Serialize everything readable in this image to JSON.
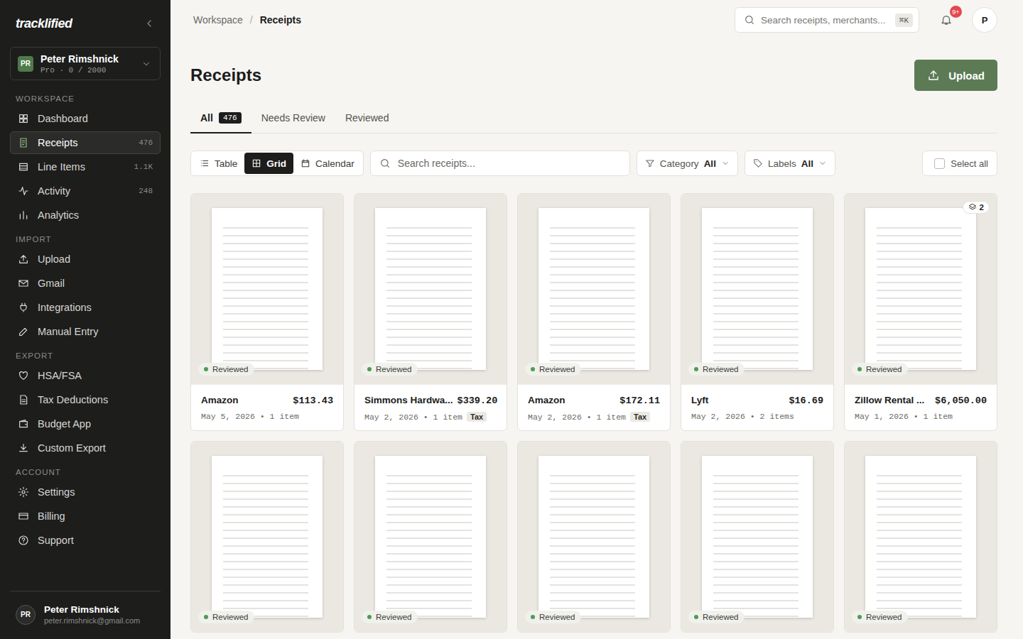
{
  "sidebar": {
    "logo": "tracklified",
    "account": {
      "initials": "PR",
      "name": "Peter Rimshnick",
      "plan": "Pro · 0 / 2000"
    },
    "sections": [
      {
        "title": "WORKSPACE",
        "items": [
          {
            "label": "Dashboard",
            "selected": false
          },
          {
            "label": "Receipts",
            "count": "476",
            "selected": true
          },
          {
            "label": "Line Items",
            "count": "1.1K",
            "selected": false
          },
          {
            "label": "Activity",
            "count": "248",
            "selected": false
          },
          {
            "label": "Analytics",
            "selected": false
          }
        ]
      },
      {
        "title": "IMPORT",
        "items": [
          {
            "label": "Upload",
            "selected": false
          },
          {
            "label": "Gmail",
            "selected": false
          },
          {
            "label": "Integrations",
            "selected": false
          },
          {
            "label": "Manual Entry",
            "selected": false
          }
        ]
      },
      {
        "title": "EXPORT",
        "items": [
          {
            "label": "HSA/FSA",
            "selected": false
          },
          {
            "label": "Tax Deductions",
            "selected": false
          },
          {
            "label": "Budget App",
            "selected": false
          },
          {
            "label": "Custom Export",
            "selected": false
          }
        ]
      },
      {
        "title": "ACCOUNT",
        "items": [
          {
            "label": "Settings",
            "selected": false
          },
          {
            "label": "Billing",
            "selected": false
          },
          {
            "label": "Support",
            "selected": false
          }
        ]
      }
    ],
    "user": {
      "initials": "PR",
      "name": "Peter Rimshnick",
      "email": "peter.rimshnick@gmail.com"
    }
  },
  "topbar": {
    "breadcrumb": [
      "Workspace",
      "Receipts"
    ],
    "separator": "/",
    "search": {
      "placeholder": "Search receipts, merchants...",
      "shortcut": "⌘K"
    },
    "notifications": "9+",
    "avatar": "P"
  },
  "page": {
    "title": "Receipts",
    "upload_button": "Upload"
  },
  "tabs": [
    {
      "label": "All",
      "count": "476",
      "selected": true
    },
    {
      "label": "Needs Review",
      "selected": false
    },
    {
      "label": "Reviewed",
      "selected": false
    }
  ],
  "toolbar": {
    "views": [
      {
        "label": "Table",
        "selected": false
      },
      {
        "label": "Grid",
        "selected": true
      },
      {
        "label": "Calendar",
        "selected": false
      }
    ],
    "search": {
      "placeholder": "Search receipts..."
    },
    "filters": [
      {
        "label": "Category",
        "value": "All"
      },
      {
        "label": "Labels",
        "value": "All"
      }
    ],
    "select_all": {
      "label": "Select all",
      "checked": false
    }
  },
  "receipts": [
    {
      "status": "Reviewed",
      "merchant": "Amazon",
      "amount": "$113.43",
      "meta": "May 5, 2026 • 1 item"
    },
    {
      "status": "Reviewed",
      "merchant": "Simmons Hardwa...",
      "amount": "$339.20",
      "meta": "May 2, 2026 • 1 item",
      "tag": "Tax"
    },
    {
      "status": "Reviewed",
      "merchant": "Amazon",
      "amount": "$172.11",
      "meta": "May 2, 2026 • 1 item",
      "tag": "Tax"
    },
    {
      "status": "Reviewed",
      "merchant": "Lyft",
      "amount": "$16.69",
      "meta": "May 2, 2026 • 2 items"
    },
    {
      "status": "Reviewed",
      "merchant": "Zillow Rental ...",
      "amount": "$6,050.00",
      "meta": "May 1, 2026 • 1 item",
      "stack": "2"
    },
    {
      "status": "Reviewed"
    },
    {
      "status": "Reviewed"
    },
    {
      "status": "Reviewed"
    },
    {
      "status": "Reviewed"
    },
    {
      "status": "Reviewed"
    }
  ]
}
